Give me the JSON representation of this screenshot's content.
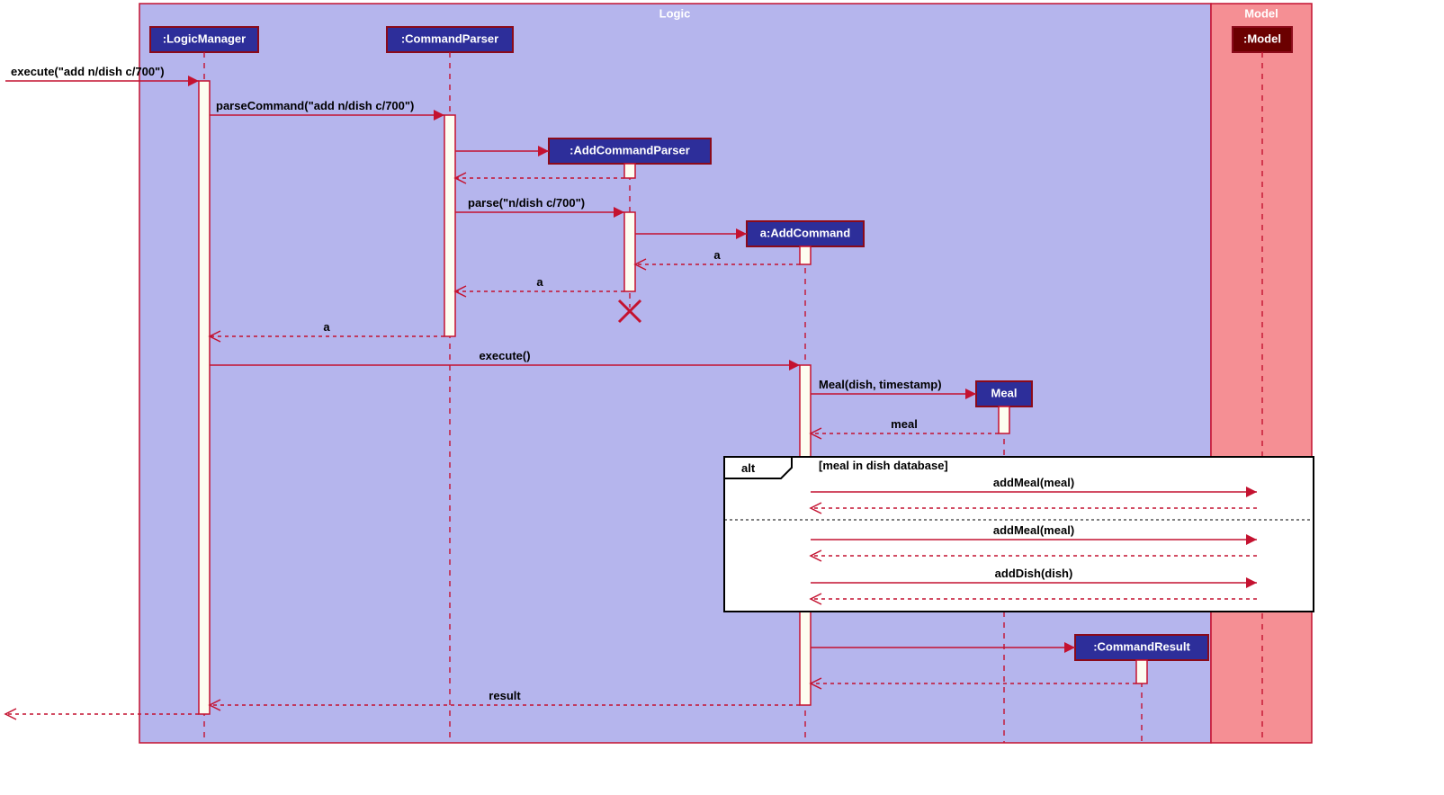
{
  "frames": {
    "logic": "Logic",
    "model": "Model"
  },
  "lifelines": {
    "logicManager": ":LogicManager",
    "commandParser": ":CommandParser",
    "addCommandParser": ":AddCommandParser",
    "addCommand": "a:AddCommand",
    "meal": "Meal",
    "commandResult": ":CommandResult",
    "model": ":Model"
  },
  "messages": {
    "execute_in": "execute(\"add n/dish c/700\")",
    "parseCommand": "parseCommand(\"add n/dish c/700\")",
    "parse": "parse(\"n/dish c/700\")",
    "ret_a1": "a",
    "ret_a2": "a",
    "ret_a3": "a",
    "execute": "execute()",
    "mealCtor": "Meal(dish, timestamp)",
    "ret_meal": "meal",
    "addMeal1": "addMeal(meal)",
    "addMeal2": "addMeal(meal)",
    "addDish": "addDish(dish)",
    "ret_result": "result"
  },
  "alt": {
    "label": "alt",
    "guard": "[meal in dish database]"
  }
}
